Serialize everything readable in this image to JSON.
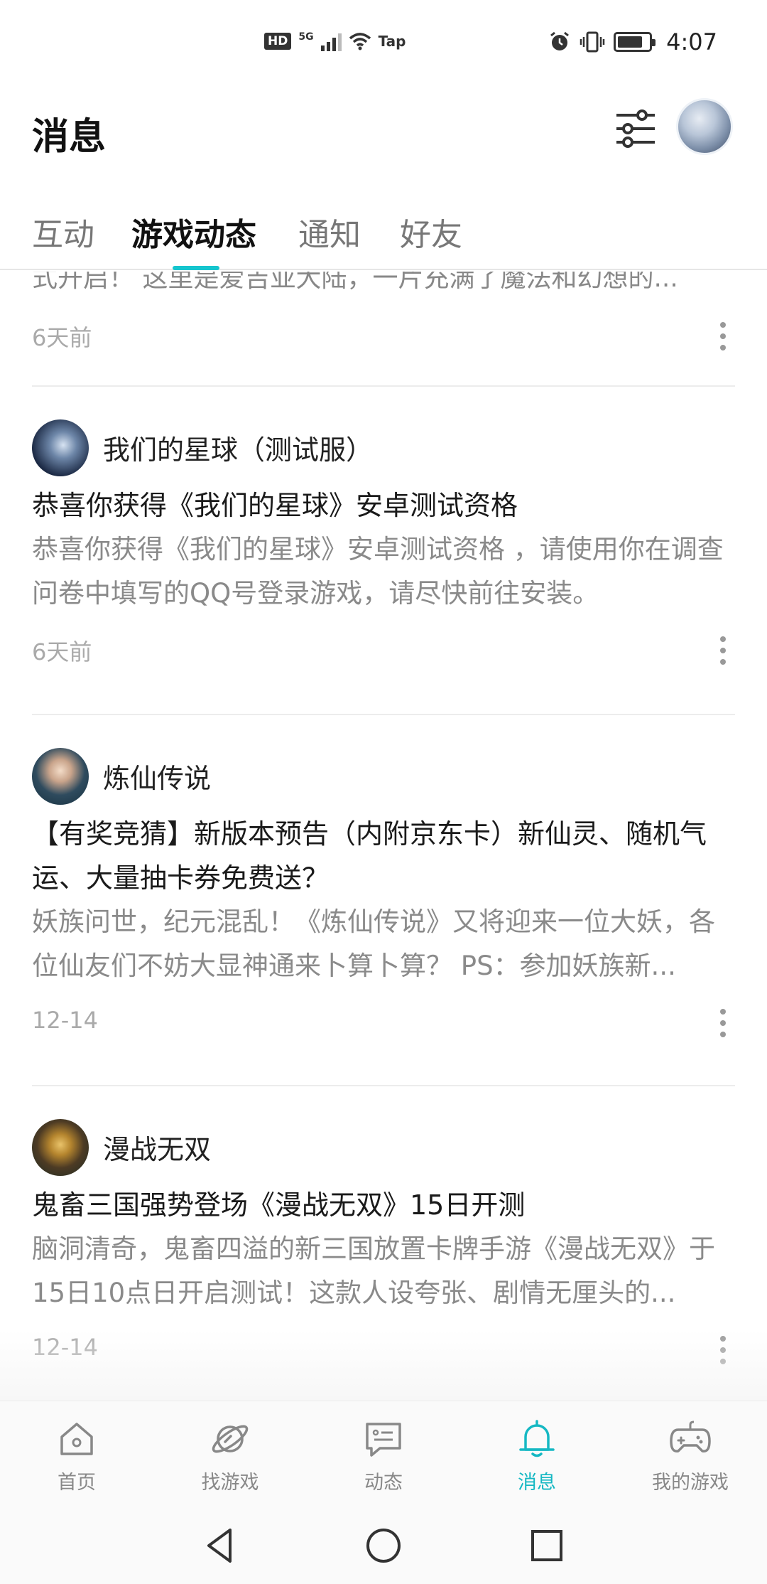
{
  "status_bar": {
    "hd": "HD",
    "network": "5G",
    "tap": "Tap",
    "time": "4:07",
    "battery_level": 0.8
  },
  "header": {
    "title": "消息",
    "filter_icon": "sliders-icon",
    "avatar_icon": "user-avatar"
  },
  "tabs": [
    {
      "label": "互动",
      "active": false
    },
    {
      "label": "游戏动态",
      "active": true
    },
    {
      "label": "通知",
      "active": false
    },
    {
      "label": "好友",
      "active": false
    }
  ],
  "feed": {
    "partial": {
      "body": "式开启！ 这里是爱吉亚大陆，一片充满了魔法和幻想的...",
      "time": "6天前"
    },
    "posts": [
      {
        "game": "我们的星球（测试服）",
        "title": "恭喜你获得《我们的星球》安卓测试资格",
        "body": "恭喜你获得《我们的星球》安卓测试资格 ，请使用你在调查问卷中填写的QQ号登录游戏，请尽快前往安装。",
        "time": "6天前"
      },
      {
        "game": "炼仙传说",
        "title": "【有奖竞猜】新版本预告（内附京东卡）新仙灵、随机气运、大量抽卡券免费送？",
        "body": "妖族问世，纪元混乱！《炼仙传说》又将迎来一位大妖，各位仙友们不妨大显神通来卜算卜算？ PS：参加妖族新...",
        "time": "12-14"
      },
      {
        "game": "漫战无双",
        "title": "鬼畜三国强势登场《漫战无双》15日开测",
        "body": "脑洞清奇，鬼畜四溢的新三国放置卡牌手游《漫战无双》于15日10点日开启测试！这款人设夸张、剧情无厘头的...",
        "time": "12-14"
      }
    ]
  },
  "bottom_nav": [
    {
      "label": "首页",
      "icon": "home-icon",
      "active": false
    },
    {
      "label": "找游戏",
      "icon": "planet-icon",
      "active": false
    },
    {
      "label": "动态",
      "icon": "chat-icon",
      "active": false
    },
    {
      "label": "消息",
      "icon": "bell-icon",
      "active": true
    },
    {
      "label": "我的游戏",
      "icon": "gamepad-icon",
      "active": false
    }
  ],
  "colors": {
    "accent": "#15c5ce",
    "active_nav": "#15b8c3",
    "muted_text": "#8a8a8a"
  }
}
